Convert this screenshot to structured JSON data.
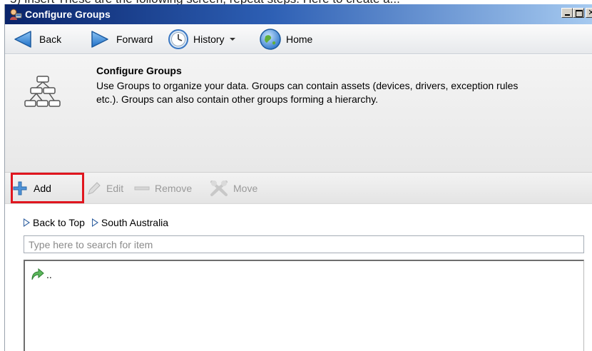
{
  "window": {
    "title": "Configure Groups",
    "behind_text": "5) Insert These are the following screen, repeat steps. Here to create a..."
  },
  "nav": {
    "back_label": "Back",
    "forward_label": "Forward",
    "history_label": "History",
    "home_label": "Home"
  },
  "header": {
    "title": "Configure Groups",
    "description": "Use Groups to organize your data. Groups can contain assets (devices, drivers, exception rules etc.). Groups can also contain other groups forming a hierarchy."
  },
  "toolbar": {
    "add_label": "Add",
    "edit_label": "Edit",
    "remove_label": "Remove",
    "move_label": "Move"
  },
  "breadcrumb": {
    "items": [
      {
        "label": "Back to Top"
      },
      {
        "label": "South Australia"
      }
    ]
  },
  "search": {
    "placeholder": "Type here to search for item",
    "value": ""
  },
  "list": {
    "items": [
      {
        "label": "..",
        "icon": "up-folder-icon"
      }
    ]
  },
  "colors": {
    "titlebar_start": "#0a246a",
    "titlebar_end": "#a6caf0",
    "highlight": "#e0161f",
    "nav_arrow": "#2f5fa0"
  }
}
